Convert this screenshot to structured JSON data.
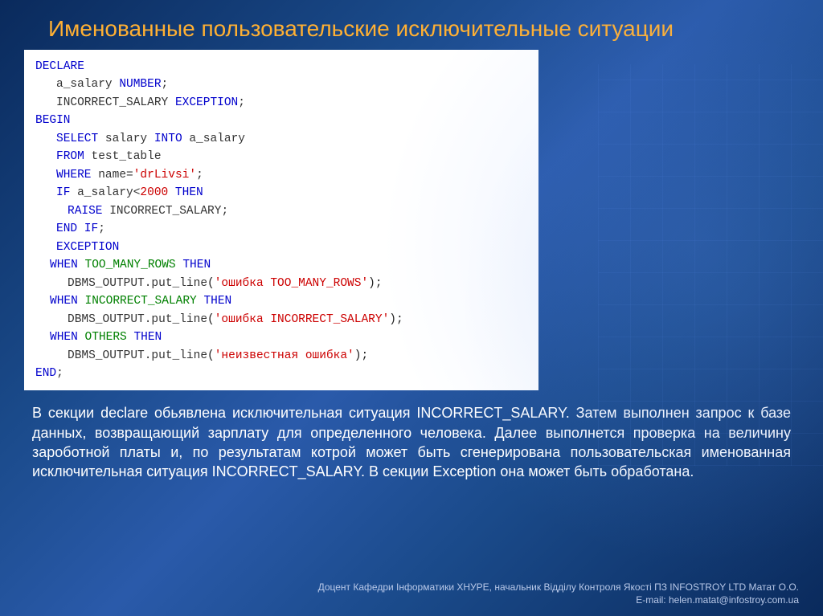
{
  "title": "Именованные пользовательские исключительные ситуации",
  "code": {
    "l1_kw": "DECLARE",
    "l2_a": "a_salary ",
    "l2_b": "NUMBER",
    "l2_c": ";",
    "l3_a": "INCORRECT_SALARY ",
    "l3_b": "EXCEPTION",
    "l3_c": ";",
    "l4_kw": "BEGIN",
    "l5_a": "SELECT",
    "l5_b": " salary ",
    "l5_c": "INTO",
    "l5_d": " a_salary",
    "l6_a": "FROM",
    "l6_b": " test_table",
    "l7_a": "WHERE",
    "l7_b": " name=",
    "l7_c": "'drLivsi'",
    "l7_d": ";",
    "l8_a": "IF",
    "l8_b": " a_salary<",
    "l8_c": "2000",
    "l8_d": " THEN",
    "l9_a": "RAISE",
    "l9_b": " INCORRECT_SALARY;",
    "l10_a": "END",
    "l10_b": " IF",
    "l10_c": ";",
    "l11_a": "EXCEPTION",
    "l12_a": "WHEN",
    "l12_b": " TOO_MANY_ROWS ",
    "l12_c": "THEN",
    "l13_a": "DBMS_OUTPUT.put_line",
    "l13_b": "(",
    "l13_c": "'ошибка TOO_MANY_ROWS'",
    "l13_d": ");",
    "l14_a": "WHEN",
    "l14_b": " INCORRECT_SALARY ",
    "l14_c": "THEN",
    "l15_a": "DBMS_OUTPUT.put_line",
    "l15_b": "(",
    "l15_c": "'ошибка INCORRECT_SALARY'",
    "l15_d": ");",
    "l16_a": "WHEN",
    "l16_b": " OTHERS ",
    "l16_c": "THEN",
    "l17_a": "DBMS_OUTPUT.put_line",
    "l17_b": "(",
    "l17_c": "'неизвестная ошибка'",
    "l17_d": ");",
    "l18_a": "END",
    "l18_b": ";"
  },
  "body": "В секции declare обьявлена исключительная ситуация INCORRECT_SALARY. Затем выполнен запрос к базе данных, возвращающий зарплату для определенного человека. Далее выполнется проверка на величину зароботной платы и, по результатам котрой может быть сгенерирована пользовательская именованная исключительная ситуация INCORRECT_SALARY. В секции Exception она может быть обработана.",
  "footer": {
    "line1": "Доцент Кафедри Інформатики ХНУРЕ, начальник Відділу Контроля Якості ПЗ INFOSTROY LTD Матат О.О.",
    "line2": "E-mail: helen.matat@infostroy.com.ua"
  }
}
